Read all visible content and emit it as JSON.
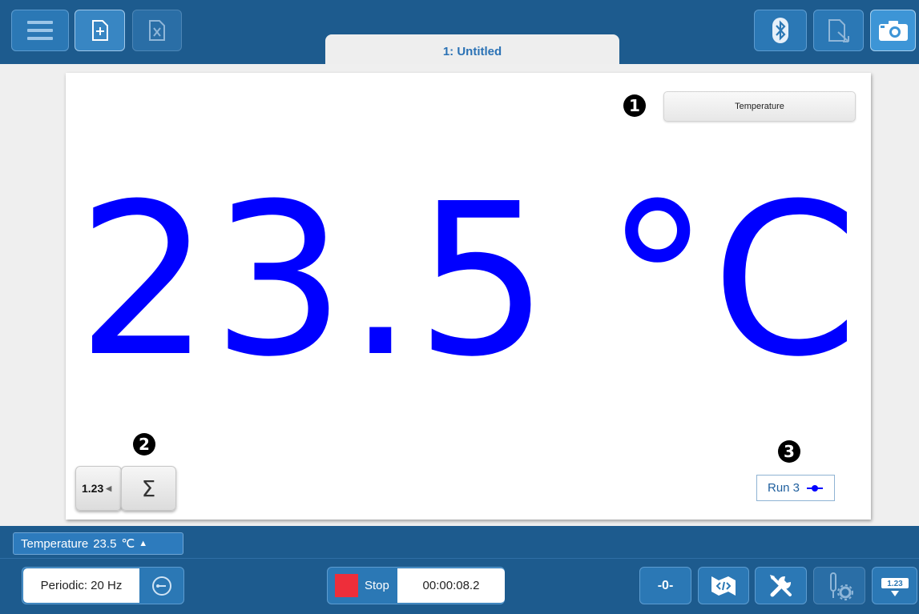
{
  "toolbar": {
    "menu_icon": "hamburger-menu-icon",
    "new_file_icon": "new-file-icon",
    "close_file_icon": "close-file-icon",
    "bluetooth_icon": "bluetooth-icon",
    "export_icon": "export-file-icon",
    "camera_icon": "camera-icon"
  },
  "tab": {
    "label": "1: Untitled"
  },
  "meter": {
    "sensor_label": "Temperature",
    "value": "23.5",
    "unit": "°C",
    "value_color": "#0000ff",
    "callouts": [
      "1",
      "2",
      "3"
    ],
    "mode_buttons": {
      "numeric_label": "1.23",
      "statistics_label": "Σ"
    },
    "run_label": "Run 3"
  },
  "bottom": {
    "meter_tag": {
      "name": "Temperature",
      "value": "23.5",
      "unit": "℃"
    },
    "collection_mode": "Periodic: 20 Hz",
    "stop_label": "Stop",
    "elapsed_time": "00:00:08.2",
    "zero_label": "-0-",
    "meter_button_label": "1.23"
  },
  "colors": {
    "bar_bg": "#1d5b8e",
    "button_bg": "#2b78b5",
    "stop_red": "#ee2e3a",
    "tab_text": "#2b72b5"
  }
}
